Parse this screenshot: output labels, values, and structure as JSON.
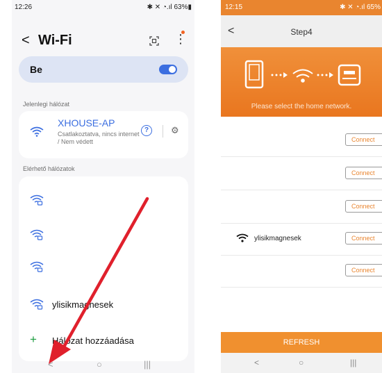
{
  "left": {
    "status": {
      "time": "12:26",
      "right": "✱ ✕ ◔.ıl 63%▮"
    },
    "title": "Wi-Fi",
    "toggle_label": "Be",
    "section_current": "Jelenlegi hálózat",
    "current": {
      "ssid": "XHOUSE-AP",
      "status": "Csatlakoztatva, nincs internet / Nem védett"
    },
    "section_available": "Elérhető hálózatok",
    "networks": [
      {
        "name": ""
      },
      {
        "name": ""
      },
      {
        "name": ""
      },
      {
        "name": "ylisikmagnesek"
      }
    ],
    "add_network": "Hálózat hozzáadása",
    "nav": {
      "back": "<",
      "home": "○",
      "recent": "|||"
    }
  },
  "right": {
    "status": {
      "time": "12:15",
      "right": "✱ ✕ ◔.ıl 65%"
    },
    "title": "Step4",
    "banner_text": "Please select the home network.",
    "rows": [
      {
        "name": "",
        "button": "Connect"
      },
      {
        "name": "",
        "button": "Connect"
      },
      {
        "name": "",
        "button": "Connect"
      },
      {
        "name": "ylisikmagnesek",
        "button": "Connect"
      },
      {
        "name": "",
        "button": "Connect"
      }
    ],
    "refresh": "REFRESH",
    "nav": {
      "back": "<",
      "home": "○",
      "recent": "|||"
    }
  },
  "colors": {
    "accent_blue": "#3b6ee0",
    "accent_orange": "#e9852f",
    "arrow_red": "#e0202c",
    "plus_green": "#1a9b3d"
  },
  "icons": [
    "wifi-icon",
    "wifi-lock-icon",
    "qr-icon",
    "more-icon",
    "help-icon",
    "settings-gear-icon",
    "plus-icon",
    "phone-icon",
    "router-icon"
  ]
}
